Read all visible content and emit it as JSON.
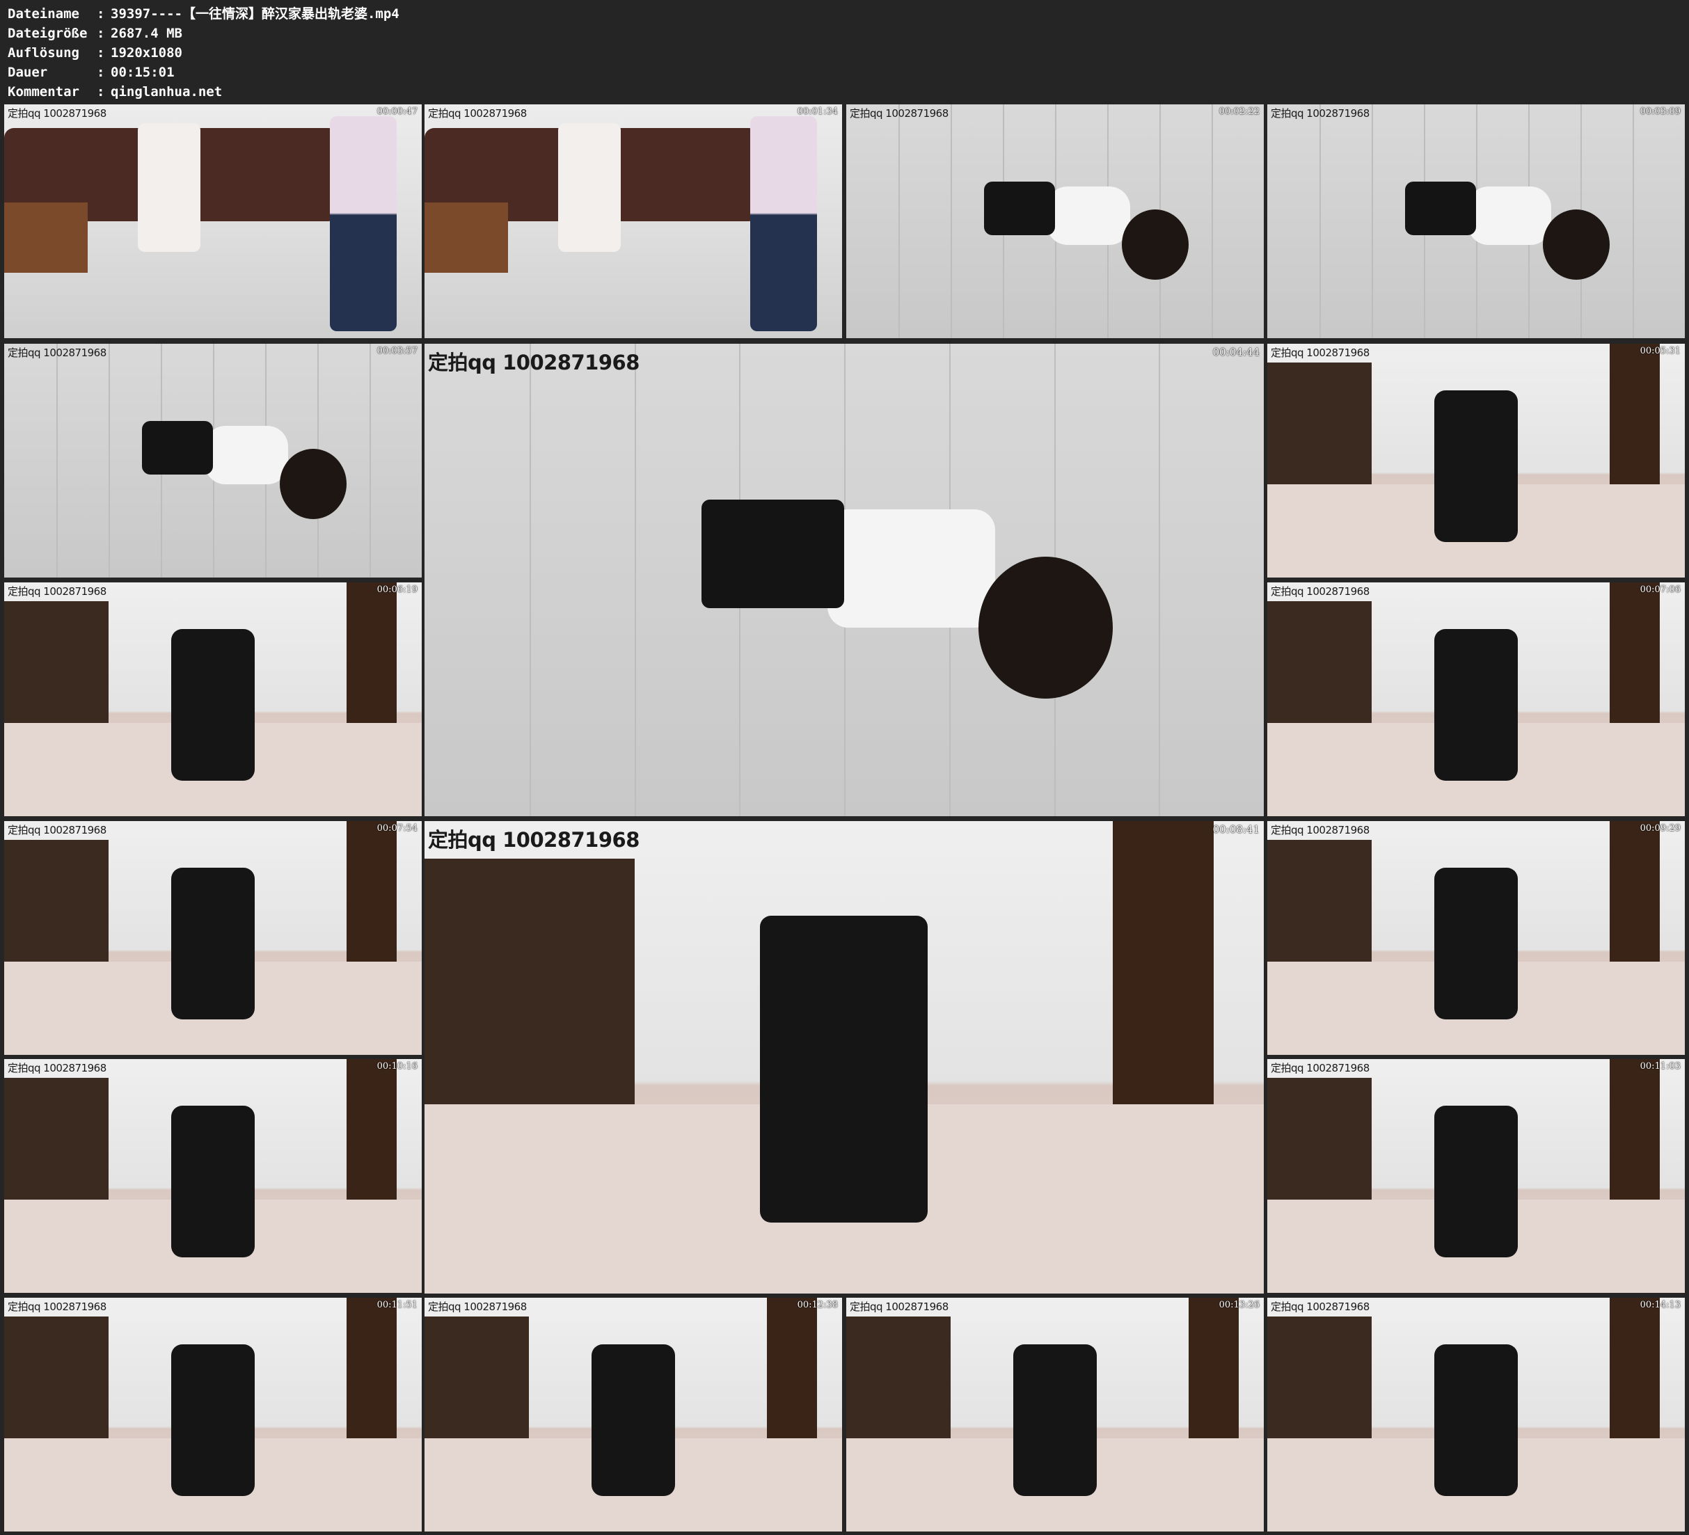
{
  "info": {
    "rows": [
      {
        "key": "Dateiname",
        "value": "39397----【一往情深】醉汉家暴出轨老婆.mp4"
      },
      {
        "key": "Dateigröße",
        "value": "2687.4 MB"
      },
      {
        "key": "Auflösung",
        "value": "1920x1080"
      },
      {
        "key": "Dauer",
        "value": "00:15:01"
      },
      {
        "key": "Kommentar",
        "value": "qinglanhua.net"
      }
    ],
    "separator": ":"
  },
  "watermark": "定拍qq 1002871968",
  "thumbnails": [
    {
      "time": "00:00:47",
      "scene": "sofa"
    },
    {
      "time": "00:01:34",
      "scene": "sofa"
    },
    {
      "time": "00:02:22",
      "scene": "floor"
    },
    {
      "time": "00:03:09",
      "scene": "floor"
    },
    {
      "time": "00:03:57",
      "scene": "floor"
    },
    {
      "time": "00:04:44",
      "scene": "floor"
    },
    {
      "time": "00:05:31",
      "scene": "bedroom"
    },
    {
      "time": "00:06:19",
      "scene": "bedroom"
    },
    {
      "time": "00:07:06",
      "scene": "bedroom"
    },
    {
      "time": "00:07:54",
      "scene": "bedroom"
    },
    {
      "time": "00:08:41",
      "scene": "bedroom"
    },
    {
      "time": "00:09:29",
      "scene": "bedroom"
    },
    {
      "time": "00:10:16",
      "scene": "bedroom"
    },
    {
      "time": "00:11:03",
      "scene": "bedroom"
    },
    {
      "time": "00:11:51",
      "scene": "bedroom"
    },
    {
      "time": "00:12:38",
      "scene": "bedroom"
    },
    {
      "time": "00:13:26",
      "scene": "bedroom"
    },
    {
      "time": "00:14:13",
      "scene": "bedroom"
    }
  ]
}
